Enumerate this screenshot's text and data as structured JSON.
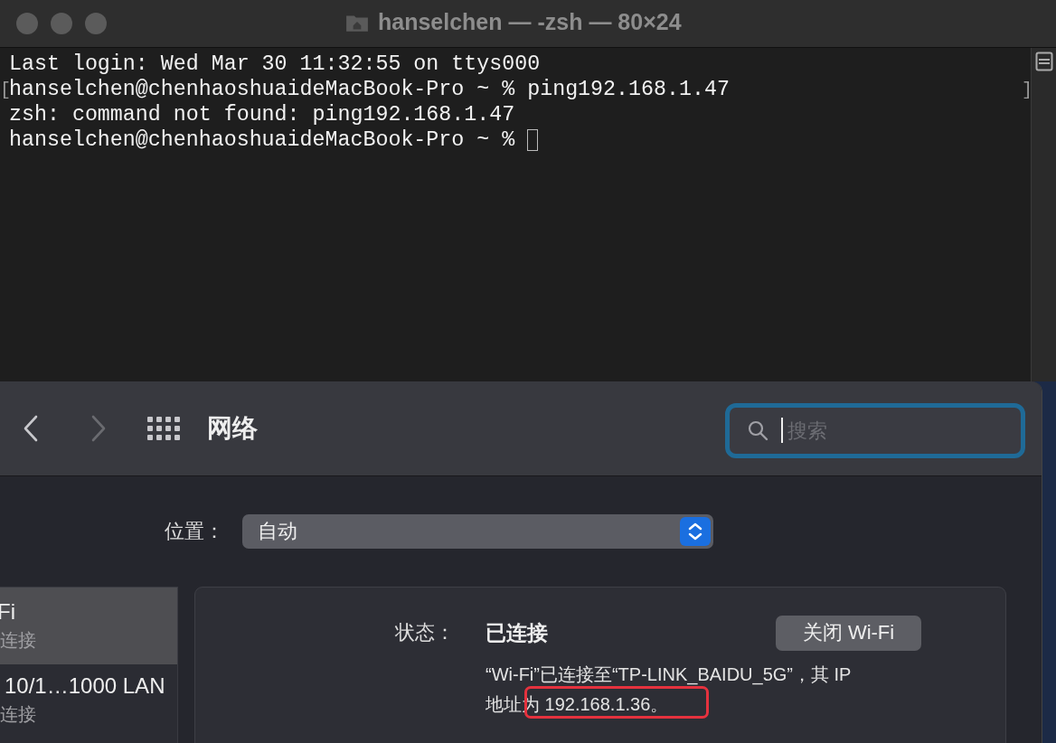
{
  "terminal": {
    "title": "hanselchen — -zsh — 80×24",
    "lines": [
      {
        "text": "Last login: Wed Mar 30 11:32:55 on ttys000"
      },
      {
        "text": "hanselchen@chenhaoshuaideMacBook-Pro ~ % ping192.168.1.47",
        "mark_open": "[",
        "mark_close": "]"
      },
      {
        "text": "zsh: command not found: ping192.168.1.47"
      },
      {
        "text": "hanselchen@chenhaoshuaideMacBook-Pro ~ % ",
        "cursor": true
      }
    ]
  },
  "preferences": {
    "title": "网络",
    "nav": [
      {
        "kind": "back",
        "disabled": false
      },
      {
        "kind": "forward",
        "disabled": true
      }
    ],
    "search": {
      "placeholder": "搜索",
      "focused": true
    },
    "location": {
      "label": "位置：",
      "value": "自动"
    },
    "services": [
      {
        "name": "Fi",
        "status": "连接",
        "selected": true
      },
      {
        "name": "10/1…1000 LAN",
        "status": "连接",
        "selected": false
      }
    ],
    "status": {
      "label": "状态：",
      "value": "已连接",
      "button": "关闭 Wi-Fi",
      "description": "“Wi-Fi”已连接至“TP-LINK_BAIDU_5G”，其 IP 地址为 192.168.1.36。",
      "highlighted": true
    }
  }
}
